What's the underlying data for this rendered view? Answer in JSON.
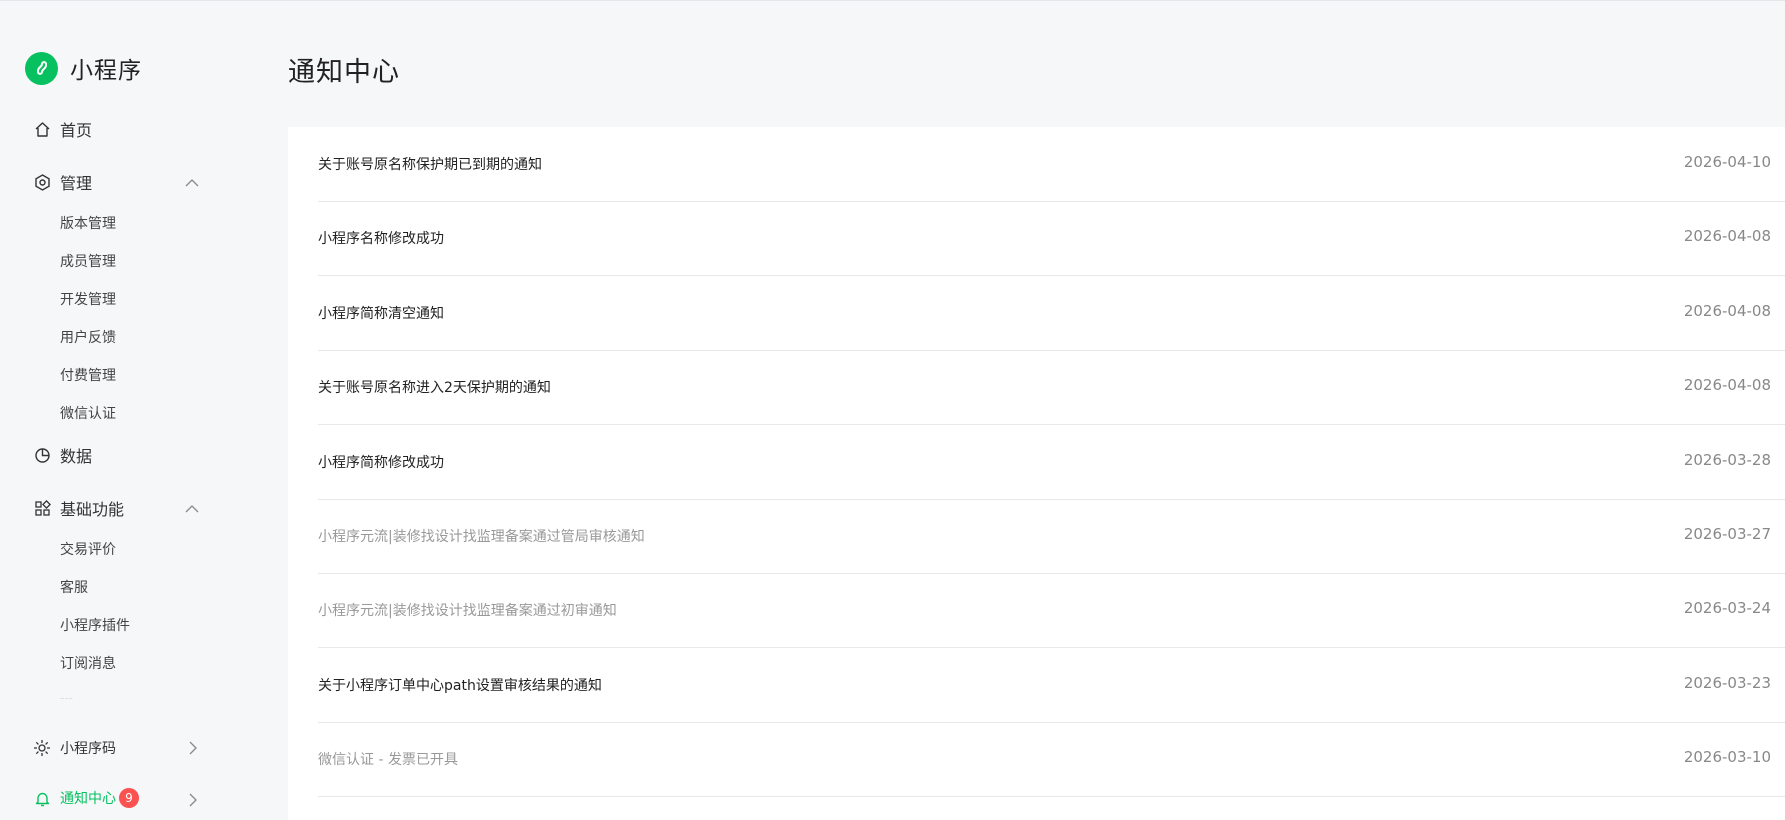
{
  "app": {
    "name": "小程序"
  },
  "sidebar": {
    "home": "首页",
    "manage": {
      "label": "管理",
      "items": [
        "版本管理",
        "成员管理",
        "开发管理",
        "用户反馈",
        "付费管理",
        "微信认证"
      ]
    },
    "data": "数据",
    "basic": {
      "label": "基础功能",
      "items": [
        "交易评价",
        "客服",
        "小程序插件",
        "订阅消息",
        "---"
      ]
    },
    "qrcode": "小程序码",
    "notify": {
      "label": "通知中心",
      "badge": "9"
    }
  },
  "main": {
    "title": "通知中心",
    "notifications": [
      {
        "title": "关于账号原名称保护期已到期的通知",
        "date": "2026-04-10",
        "read": false
      },
      {
        "title": "小程序名称修改成功",
        "date": "2026-04-08",
        "read": false
      },
      {
        "title": "小程序简称清空通知",
        "date": "2026-04-08",
        "read": false
      },
      {
        "title": "关于账号原名称进入2天保护期的通知",
        "date": "2026-04-08",
        "read": false
      },
      {
        "title": "小程序简称修改成功",
        "date": "2026-03-28",
        "read": false
      },
      {
        "title": "小程序元流|装修找设计找监理备案通过管局审核通知",
        "date": "2026-03-27",
        "read": true
      },
      {
        "title": "小程序元流|装修找设计找监理备案通过初审通知",
        "date": "2026-03-24",
        "read": true
      },
      {
        "title": "关于小程序订单中心path设置审核结果的通知",
        "date": "2026-03-23",
        "read": false
      },
      {
        "title": "微信认证 - 发票已开具",
        "date": "2026-03-10",
        "read": true
      }
    ]
  },
  "colors": {
    "brand": "#07c160",
    "badge": "#fa5151"
  }
}
